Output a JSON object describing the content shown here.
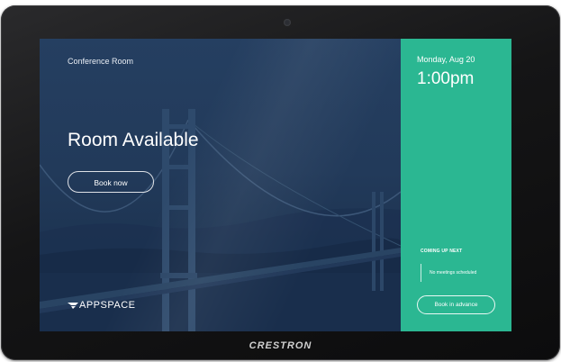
{
  "device": {
    "brand": "CRESTRON"
  },
  "main": {
    "room_name": "Conference Room",
    "status": "Room Available",
    "book_button": "Book now",
    "logo_text": "APPSPACE"
  },
  "sidebar": {
    "date": "Monday, Aug 20",
    "time": "1:00pm",
    "next_heading": "COMING UP NEXT",
    "next_text": "No meetings scheduled",
    "advance_button": "Book in advance"
  },
  "colors": {
    "accent_green": "#2bb792",
    "overlay_navy": "#223a5a"
  }
}
